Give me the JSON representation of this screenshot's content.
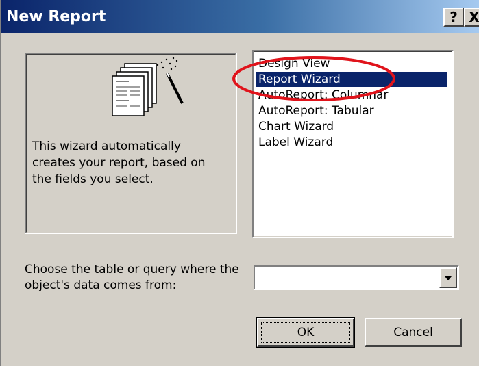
{
  "window": {
    "title": "New Report",
    "help_label": "?",
    "close_label": "X"
  },
  "preview": {
    "icon": "report-wizard-icon",
    "description": "This wizard automatically creates your report, based on the fields you select."
  },
  "report_types": [
    {
      "label": "Design View",
      "selected": false
    },
    {
      "label": "Report Wizard",
      "selected": true
    },
    {
      "label": "AutoReport: Columnar",
      "selected": false
    },
    {
      "label": "AutoReport: Tabular",
      "selected": false
    },
    {
      "label": "Chart Wizard",
      "selected": false
    },
    {
      "label": "Label Wizard",
      "selected": false
    }
  ],
  "annotation": {
    "shape": "ellipse",
    "color": "#e0131b"
  },
  "source": {
    "label": "Choose the table or query where the object's data comes from:",
    "value": ""
  },
  "buttons": {
    "ok_label": "OK",
    "cancel_label": "Cancel"
  },
  "colors": {
    "titlebar_start": "#0a246a",
    "titlebar_end": "#a6caf0",
    "selection": "#0a246a",
    "dialog_face": "#d4d0c8"
  }
}
